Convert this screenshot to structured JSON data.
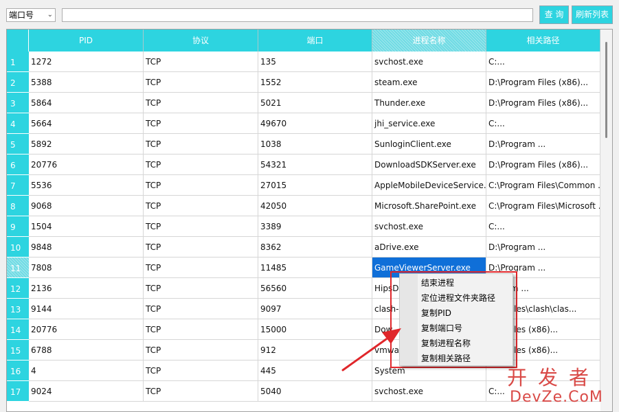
{
  "toolbar": {
    "filter_selected": "端口号",
    "search_value": "",
    "query_label": "查 询",
    "refresh_label": "刷新列表",
    "accent": "#2dd4e0"
  },
  "table": {
    "columns": [
      "PID",
      "协议",
      "端口",
      "进程名称",
      "相关路径"
    ],
    "rows": [
      {
        "n": "1",
        "pid": "1272",
        "proto": "TCP",
        "port": "135",
        "name": "svchost.exe",
        "path": "C:..."
      },
      {
        "n": "2",
        "pid": "5388",
        "proto": "TCP",
        "port": "1552",
        "name": "steam.exe",
        "path": "D:\\Program Files (x86)..."
      },
      {
        "n": "3",
        "pid": "5864",
        "proto": "TCP",
        "port": "5021",
        "name": "Thunder.exe",
        "path": "D:\\Program Files (x86)..."
      },
      {
        "n": "4",
        "pid": "5664",
        "proto": "TCP",
        "port": "49670",
        "name": "jhi_service.exe",
        "path": "C:..."
      },
      {
        "n": "5",
        "pid": "5892",
        "proto": "TCP",
        "port": "1038",
        "name": "SunloginClient.exe",
        "path": "D:\\Program ..."
      },
      {
        "n": "6",
        "pid": "20776",
        "proto": "TCP",
        "port": "54321",
        "name": "DownloadSDKServer.exe",
        "path": "D:\\Program Files (x86)..."
      },
      {
        "n": "7",
        "pid": "5536",
        "proto": "TCP",
        "port": "27015",
        "name": "AppleMobileDeviceService.e...",
        "path": "C:\\Program Files\\Common ..."
      },
      {
        "n": "8",
        "pid": "9068",
        "proto": "TCP",
        "port": "42050",
        "name": "Microsoft.SharePoint.exe",
        "path": "C:\\Program Files\\Microsoft ..."
      },
      {
        "n": "9",
        "pid": "1504",
        "proto": "TCP",
        "port": "3389",
        "name": "svchost.exe",
        "path": "C:..."
      },
      {
        "n": "10",
        "pid": "9848",
        "proto": "TCP",
        "port": "8362",
        "name": "aDrive.exe",
        "path": "D:\\Program ..."
      },
      {
        "n": "11",
        "pid": "7808",
        "proto": "TCP",
        "port": "11485",
        "name": "GameViewerServer.exe",
        "path": "D:\\Program ..."
      },
      {
        "n": "12",
        "pid": "2136",
        "proto": "TCP",
        "port": "56560",
        "name": "HipsD",
        "path": "rogram ..."
      },
      {
        "n": "13",
        "pid": "9144",
        "proto": "TCP",
        "port": "9097",
        "name": "clash-",
        "path": "ram Files\\clash\\clas..."
      },
      {
        "n": "14",
        "pid": "20776",
        "proto": "TCP",
        "port": "15000",
        "name": "Dow",
        "path": "ram Files (x86)..."
      },
      {
        "n": "15",
        "pid": "6788",
        "proto": "TCP",
        "port": "912",
        "name": "vmwa",
        "path": "ram Files (x86)..."
      },
      {
        "n": "16",
        "pid": "4",
        "proto": "TCP",
        "port": "445",
        "name": "System",
        "path": ""
      },
      {
        "n": "17",
        "pid": "9024",
        "proto": "TCP",
        "port": "5040",
        "name": "svchost.exe",
        "path": "C:..."
      }
    ]
  },
  "context_menu": {
    "items": [
      "结束进程",
      "定位进程文件夹路径",
      "复制PID",
      "复制端口号",
      "复制进程名称",
      "复制相关路径"
    ]
  },
  "watermark": {
    "top": "开发者",
    "bottom": "DevZe.CoM"
  }
}
